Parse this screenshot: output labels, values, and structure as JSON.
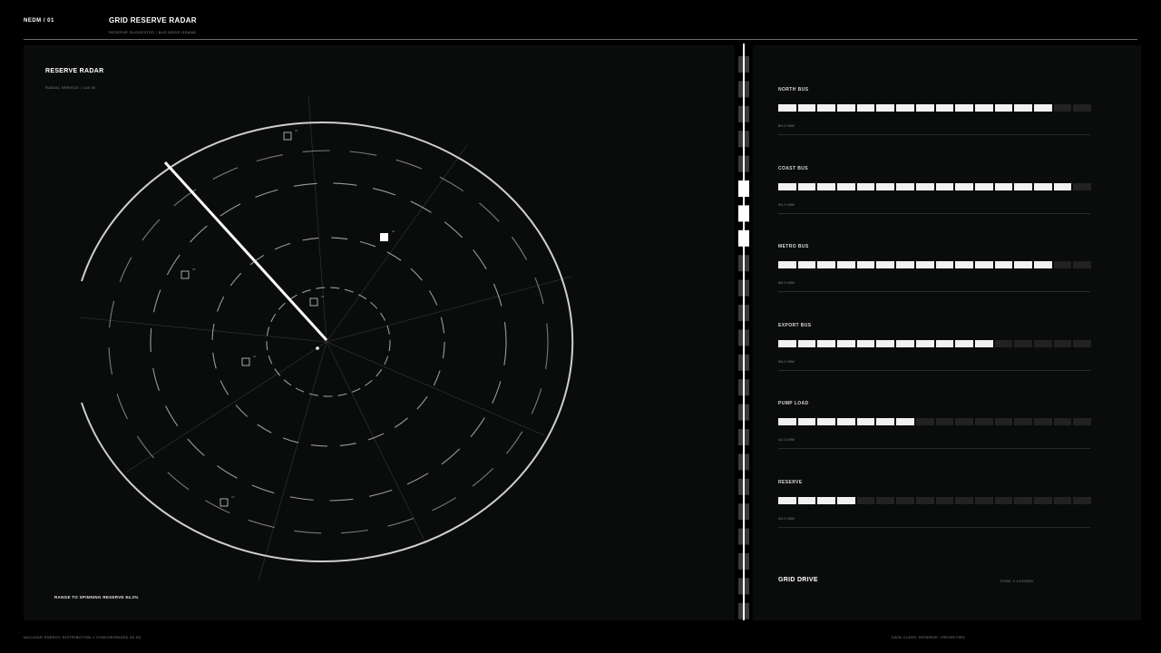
{
  "header": {
    "code": "NEDM / 01",
    "title": "GRID RESERVE RADAR",
    "subtitle": "RESERVE SUGGESTED / BUS DRIVE GRAND"
  },
  "radar": {
    "title": "RESERVE RADAR",
    "subtitle": "RADIAL SERVICE / 144.90",
    "footer": "RANGE TO SPINNING RESERVE 84.2%",
    "targets": [
      {
        "label": "04"
      },
      {
        "label": "02"
      },
      {
        "label": "05"
      },
      {
        "label": "06"
      },
      {
        "label": "01"
      },
      {
        "label": "03"
      }
    ]
  },
  "meters": [
    {
      "name": "NORTH BUS",
      "value": "89.0 MW",
      "level": 0.875
    },
    {
      "name": "COAST BUS",
      "value": "96.0 MW",
      "level": 0.9375
    },
    {
      "name": "METRO BUS",
      "value": "88.0 MW",
      "level": 0.875
    },
    {
      "name": "EXPORT BUS",
      "value": "65.0 MW",
      "level": 0.6875
    },
    {
      "name": "PUMP LOAD",
      "value": "42.0 MW",
      "level": 0.4375
    },
    {
      "name": "RESERVE",
      "value": "26.0 MW",
      "level": 0.25
    }
  ],
  "drive": {
    "title": "GRID DRIVE",
    "status": "SYNC // LOCKED"
  },
  "footer": {
    "left": "NUCLEAR ENERGY DISTRIBUTION // SYNCHRONIZED 60 HZ",
    "right": "DATA CLASS: RESERVE / PRIORITIES"
  },
  "colors": {
    "background": "#000000",
    "panel": "#0a0c0b",
    "accent": "#f1f1f1",
    "segment_off": "#222222"
  }
}
